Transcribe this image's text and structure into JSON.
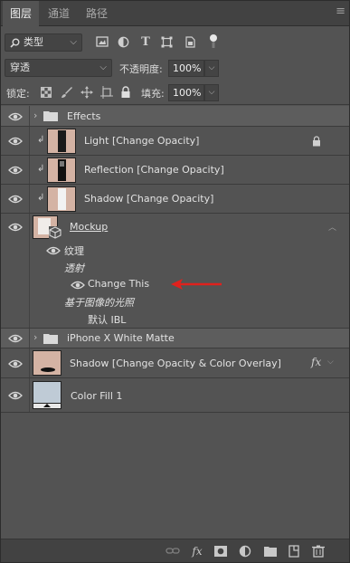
{
  "tabs": [
    "图层",
    "通道",
    "路径"
  ],
  "filter": {
    "kind_label": "类型"
  },
  "blend": {
    "mode": "穿透",
    "opacity_label": "不透明度:",
    "opacity_value": "100%"
  },
  "lock": {
    "label": "锁定:",
    "fill_label": "填充:",
    "fill_value": "100%"
  },
  "layers": {
    "effects_group": "Effects",
    "light": "Light [Change Opacity]",
    "reflection": "Reflection [Change Opacity]",
    "shadow_clip": "Shadow [Change Opacity]",
    "mockup": "Mockup",
    "texture": "纹理",
    "transmission": "透射",
    "change_this": "Change This",
    "image_based_light": "基于图像的光照",
    "default_ibl": "默认 IBL",
    "iphone_group": "iPhone X White Matte",
    "shadow_main": "Shadow [Change Opacity & Color Overlay]",
    "color_fill": "Color Fill 1"
  },
  "fx_label": "fx",
  "colors": {
    "panel": "#535353",
    "tab_bar": "#424242",
    "arrow": "#e0211d",
    "group_row": "#5d5d5d"
  },
  "icons": [
    "search-icon",
    "image-filter-icon",
    "adjustment-filter-icon",
    "type-filter-icon",
    "shape-filter-icon",
    "smart-object-filter-icon",
    "filter-toggle-icon",
    "eye-icon",
    "folder-icon",
    "lock-icon",
    "clip-arrow-icon",
    "link-icon",
    "fx-icon",
    "mask-icon",
    "adjustment-icon",
    "new-group-icon",
    "new-layer-icon",
    "trash-icon"
  ]
}
